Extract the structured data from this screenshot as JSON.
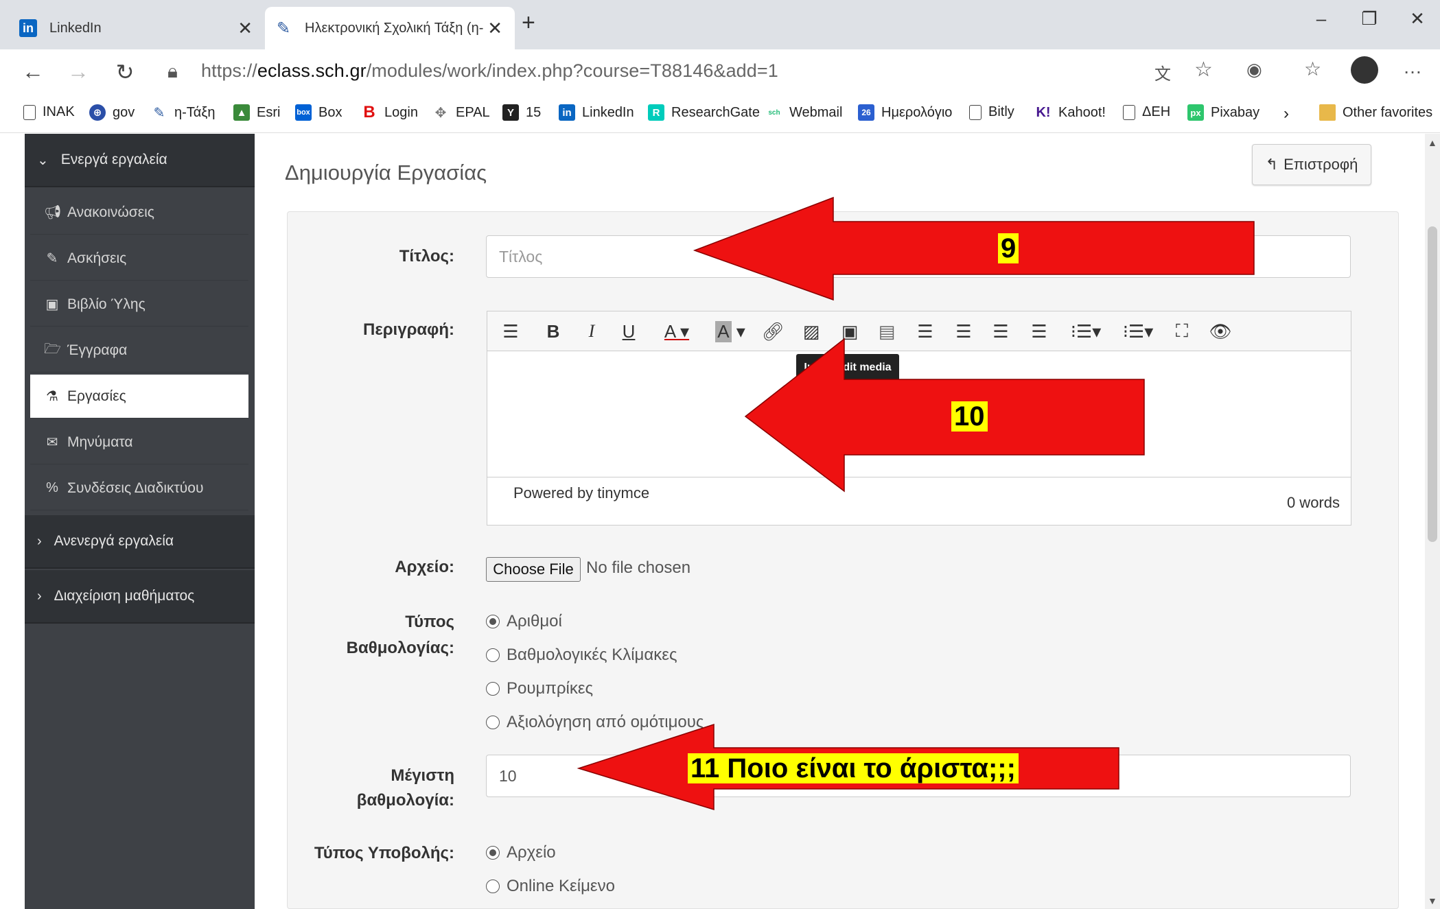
{
  "browser": {
    "tabs": [
      {
        "label": "LinkedIn",
        "icon": "linkedin-icon"
      },
      {
        "label": "Ηλεκτρονική Σχολική Τάξη (η-Τά",
        "icon": "eclass-icon"
      }
    ],
    "new_tab": "+",
    "window_controls": {
      "minimize": "–",
      "restore": "❐",
      "close": "✕"
    },
    "url": {
      "prefix": "https://",
      "domain": "eclass.sch.gr",
      "path": "/modules/work/index.php?course=T88146&add=1"
    },
    "favorites": [
      {
        "label": "INAK",
        "icon": "page-icon"
      },
      {
        "label": "gov",
        "icon": "gov-icon"
      },
      {
        "label": "η-Τάξη",
        "icon": "eclass-icon"
      },
      {
        "label": "Esri",
        "icon": "esri-icon"
      },
      {
        "label": "Box",
        "icon": "box-icon"
      },
      {
        "label": "Login",
        "icon": "b-icon"
      },
      {
        "label": "EPAL",
        "icon": "epal-icon"
      },
      {
        "label": "15",
        "icon": "15-icon"
      },
      {
        "label": "LinkedIn",
        "icon": "linkedin-icon"
      },
      {
        "label": "ResearchGate",
        "icon": "researchgate-icon"
      },
      {
        "label": "Webmail",
        "icon": "webmail-icon"
      },
      {
        "label": "Ημερολόγιο",
        "icon": "calendar-icon"
      },
      {
        "label": "Bitly",
        "icon": "page-icon"
      },
      {
        "label": "Kahoot!",
        "icon": "kahoot-icon"
      },
      {
        "label": "ΔΕΗ",
        "icon": "page-icon"
      },
      {
        "label": "Pixabay",
        "icon": "pixabay-icon"
      }
    ],
    "other_favorites": "Other favorites"
  },
  "sidebar": {
    "active_tools": "Ενεργά εργαλεία",
    "items": [
      {
        "label": "Ανακοινώσεις",
        "icon": "megaphone-icon"
      },
      {
        "label": "Ασκήσεις",
        "icon": "edit-icon"
      },
      {
        "label": "Βιβλίο Ύλης",
        "icon": "calendar-icon"
      },
      {
        "label": "Έγγραφα",
        "icon": "folder-icon"
      },
      {
        "label": "Εργασίες",
        "icon": "flask-icon"
      },
      {
        "label": "Μηνύματα",
        "icon": "envelope-icon"
      },
      {
        "label": "Συνδέσεις Διαδικτύου",
        "icon": "link-icon"
      }
    ],
    "inactive_tools": "Ανενεργά εργαλεία",
    "course_admin": "Διαχείριση μαθήματος"
  },
  "main": {
    "title": "Δημιουργία Εργασίας",
    "back_button": "Επιστροφή",
    "form": {
      "title_label": "Τίτλος:",
      "title_placeholder": "Τίτλος",
      "description_label": "Περιγραφή:",
      "editor_tooltip": "Insert/edit media",
      "editor_powered": "Powered by tinymce",
      "editor_words": "0 words",
      "file_label": "Αρχείο:",
      "choose_file": "Choose File",
      "no_file": "No file chosen",
      "grading_label_1": "Τύπος",
      "grading_label_2": "Βαθμολογίας:",
      "grading_options": [
        {
          "label": "Αριθμοί",
          "selected": true
        },
        {
          "label": "Βαθμολογικές Κλίμακες",
          "selected": false
        },
        {
          "label": "Ρουμπρίκες",
          "selected": false
        },
        {
          "label": "Αξιολόγηση από ομότιμους",
          "selected": false
        }
      ],
      "max_grade_label_1": "Μέγιστη",
      "max_grade_label_2": "βαθμολογία:",
      "max_grade_value": "10",
      "submission_label": "Τύπος Υποβολής:",
      "submission_options": [
        {
          "label": "Αρχείο",
          "selected": true
        },
        {
          "label": "Online Κείμενο",
          "selected": false
        }
      ]
    }
  },
  "annotations": {
    "a9": "9",
    "a10": "10",
    "a11": "11 Ποιο είναι το άριστα;;;",
    "arrow_color": "#ee1111",
    "highlight_color": "#ffff00"
  },
  "colors": {
    "sidebar_bg": "#3e4146",
    "sidebar_group_bg": "#2f3236",
    "chrome_bg": "#dee1e6"
  }
}
